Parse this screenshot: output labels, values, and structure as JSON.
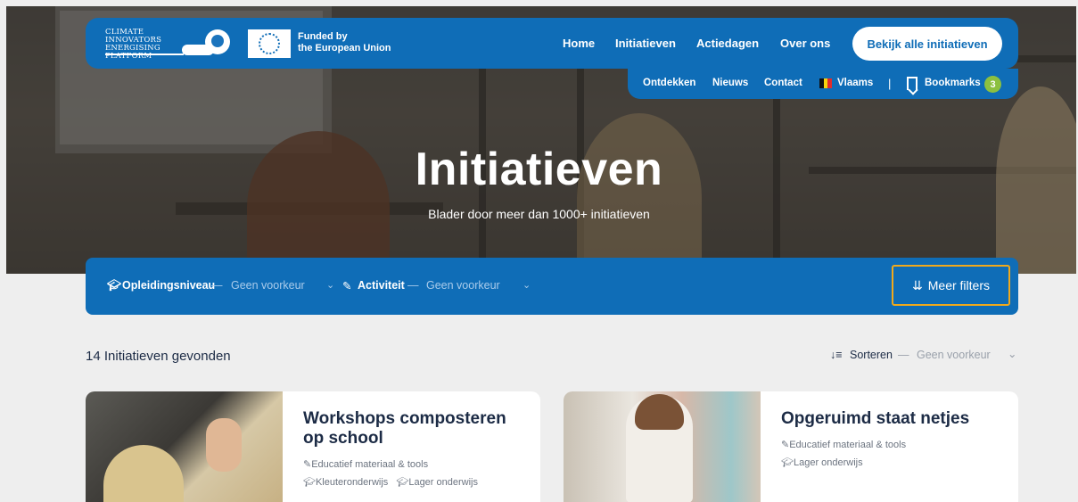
{
  "nav": {
    "logo_text": "CLIMATE INNOVATORS ENERGISING PLATFORM",
    "eu_label": "Funded by the European Union",
    "eu_line1": "Funded by",
    "eu_line2": "the European Union",
    "menu": [
      "Home",
      "Initiatieven",
      "Actiedagen",
      "Over ons"
    ],
    "cta": "Bekijk alle initiatieven",
    "sub": [
      "Ontdekken",
      "Nieuws",
      "Contact"
    ],
    "language": "Vlaams",
    "bookmarks_label": "Bookmarks",
    "bookmarks_count": "3"
  },
  "hero": {
    "title": "Initiatieven",
    "subtitle": "Blader door meer dan 1000+ initiatieven"
  },
  "filters": {
    "level_label": "Opleidingsniveau",
    "level_value": "Geen voorkeur",
    "activity_label": "Activiteit",
    "activity_value": "Geen voorkeur",
    "dash": "—",
    "more": "Meer filters"
  },
  "results": {
    "count_text": "14 Initiatieven gevonden",
    "sort_label": "Sorteren",
    "sort_value": "Geen voorkeur"
  },
  "cards": [
    {
      "title": "Workshops composteren op school",
      "category": "Educatief materiaal & tools",
      "levels": [
        "Kleuteronderwijs",
        "Lager onderwijs"
      ]
    },
    {
      "title": "Opgeruimd staat netjes",
      "category": "Educatief materiaal & tools",
      "levels": [
        "Lager onderwijs"
      ]
    }
  ],
  "icons": {
    "graduation": "graduation-cap-icon",
    "pencil": "pencil-icon",
    "chevron": "chevron-down-icon",
    "sliders": "sliders-icon",
    "sort": "sort-icon",
    "bookmark": "bookmark-icon"
  },
  "colors": {
    "brand_blue": "#0f6db7",
    "highlight_orange": "#f0a91c",
    "badge_green": "#8cc03f"
  }
}
